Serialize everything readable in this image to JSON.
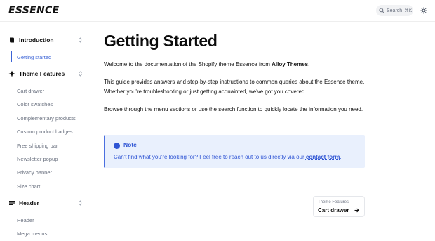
{
  "header": {
    "logo": "ESSENCE",
    "search_label": "Search",
    "search_shortcut": "⌘K",
    "icons": [
      "search-icon",
      "theme-toggle-icon"
    ]
  },
  "sidebar": {
    "sections": [
      {
        "label": "Introduction",
        "icon": "book-icon",
        "items": [
          {
            "label": "Getting started",
            "active": true
          }
        ]
      },
      {
        "label": "Theme Features",
        "icon": "sparkle-icon",
        "items": [
          {
            "label": "Cart drawer"
          },
          {
            "label": "Color swatches"
          },
          {
            "label": "Complementary products"
          },
          {
            "label": "Custom product badges"
          },
          {
            "label": "Free shipping bar"
          },
          {
            "label": "Newsletter popup"
          },
          {
            "label": "Privacy banner"
          },
          {
            "label": "Size chart"
          }
        ]
      },
      {
        "label": "Header",
        "icon": "menu-icon",
        "items": [
          {
            "label": "Header"
          },
          {
            "label": "Mega menus"
          }
        ]
      }
    ]
  },
  "main": {
    "title": "Getting Started",
    "para1_before": "Welcome to the documentation of the Shopify theme Essence from ",
    "para1_link": "Alloy Themes",
    "para1_after": ".",
    "para2": "This guide provides answers and step-by-step instructions to common queries about the Essence theme. Whether you're troubleshooting or just getting acquainted, we've got you covered.",
    "para3": "Browse through the menu sections or use the search function to quickly locate the information you need.",
    "note": {
      "title": "Note",
      "text_before": "Can't find what you're looking for? Feel free to reach out to us directly via our ",
      "link": "contact form",
      "text_after": "."
    },
    "next": {
      "section": "Theme Features",
      "title": "Cart drawer"
    }
  },
  "colors": {
    "accent": "#3b63d6",
    "note_bg": "#e9f0fd",
    "note_text": "#2f55d4"
  }
}
